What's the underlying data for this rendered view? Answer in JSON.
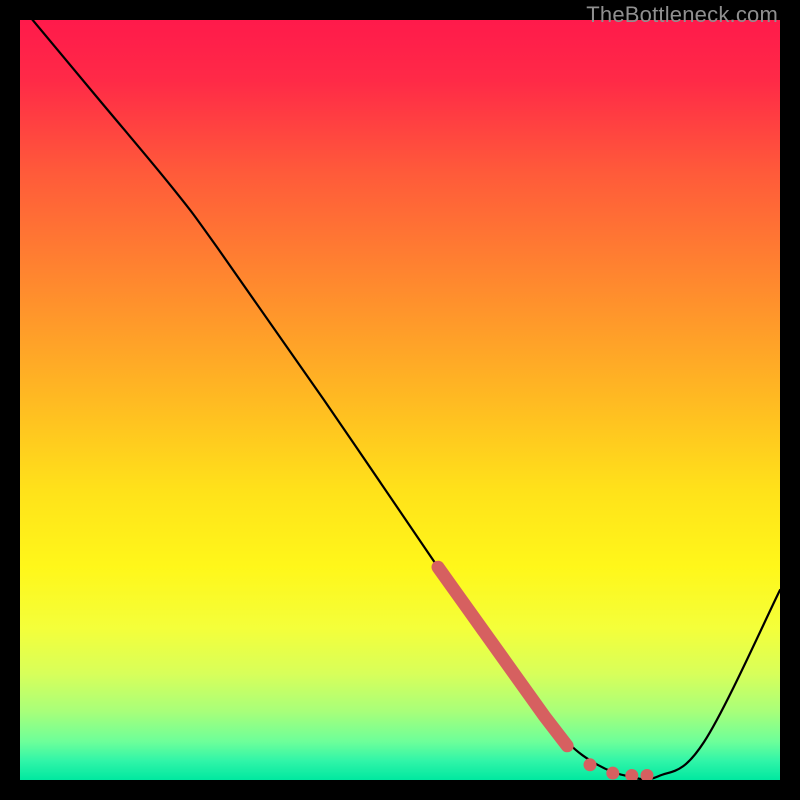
{
  "watermark": "TheBottleneck.com",
  "chart_data": {
    "type": "line",
    "title": "",
    "xlabel": "",
    "ylabel": "",
    "xlim": [
      0,
      100
    ],
    "ylim": [
      0,
      100
    ],
    "series": [
      {
        "name": "bottleneck-curve",
        "x": [
          0,
          10,
          20,
          26,
          40,
          55,
          62,
          68,
          72,
          76,
          80,
          84,
          90,
          100
        ],
        "y": [
          102,
          90,
          78,
          70,
          50,
          28,
          18,
          10,
          5,
          2,
          0.5,
          0.5,
          5,
          25
        ],
        "color": "#000000"
      }
    ],
    "highlight_segment": {
      "name": "highlighted-range",
      "color": "#d66060",
      "points_x": [
        55,
        57,
        59,
        61,
        63,
        65,
        67,
        69,
        72,
        75,
        78,
        80.5,
        82.5
      ],
      "points_y": [
        28,
        25.2,
        22.4,
        19.6,
        16.8,
        14,
        11.2,
        8.4,
        4.5,
        2.0,
        0.9,
        0.6,
        0.6
      ],
      "solid_until_index": 8,
      "dot_indices": [
        9,
        10,
        11,
        12
      ]
    },
    "gradient_stops": [
      {
        "offset": 0.0,
        "color": "#ff1a4b"
      },
      {
        "offset": 0.08,
        "color": "#ff2a47"
      },
      {
        "offset": 0.2,
        "color": "#ff5a3a"
      },
      {
        "offset": 0.35,
        "color": "#ff8a2e"
      },
      {
        "offset": 0.5,
        "color": "#ffba22"
      },
      {
        "offset": 0.62,
        "color": "#ffe21a"
      },
      {
        "offset": 0.72,
        "color": "#fff71a"
      },
      {
        "offset": 0.8,
        "color": "#f4ff3a"
      },
      {
        "offset": 0.86,
        "color": "#d8ff5a"
      },
      {
        "offset": 0.91,
        "color": "#a8ff7a"
      },
      {
        "offset": 0.95,
        "color": "#6cff9a"
      },
      {
        "offset": 0.975,
        "color": "#30f5a8"
      },
      {
        "offset": 1.0,
        "color": "#00e8a0"
      }
    ]
  }
}
